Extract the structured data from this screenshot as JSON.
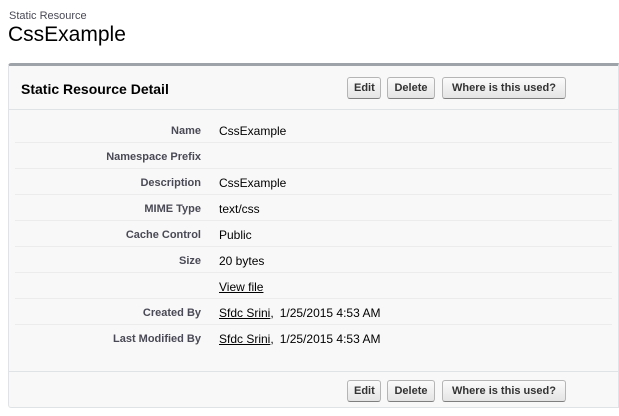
{
  "page": {
    "breadcrumb": "Static Resource",
    "title": "CssExample"
  },
  "panel": {
    "title": "Static Resource Detail",
    "buttons": {
      "edit": "Edit",
      "delete": "Delete",
      "where_used": "Where is this used?"
    }
  },
  "fields": [
    {
      "label": "Name",
      "value": "CssExample"
    },
    {
      "label": "Namespace Prefix",
      "value": ""
    },
    {
      "label": "Description",
      "value": "CssExample"
    },
    {
      "label": "MIME Type",
      "value": "text/css"
    },
    {
      "label": "Cache Control",
      "value": "Public"
    },
    {
      "label": "Size",
      "value": "20 bytes"
    },
    {
      "label": "",
      "value": "View file"
    },
    {
      "label": "Created By",
      "user": "Sfdc Srini",
      "date": "1/25/2015 4:53 AM"
    },
    {
      "label": "Last Modified By",
      "user": "Sfdc Srini",
      "date": "1/25/2015 4:53 AM"
    }
  ],
  "colors": {
    "panel_bg": "#f8f8f8",
    "panel_top_border": "#9da3a8",
    "label_text": "#4a4a56"
  }
}
